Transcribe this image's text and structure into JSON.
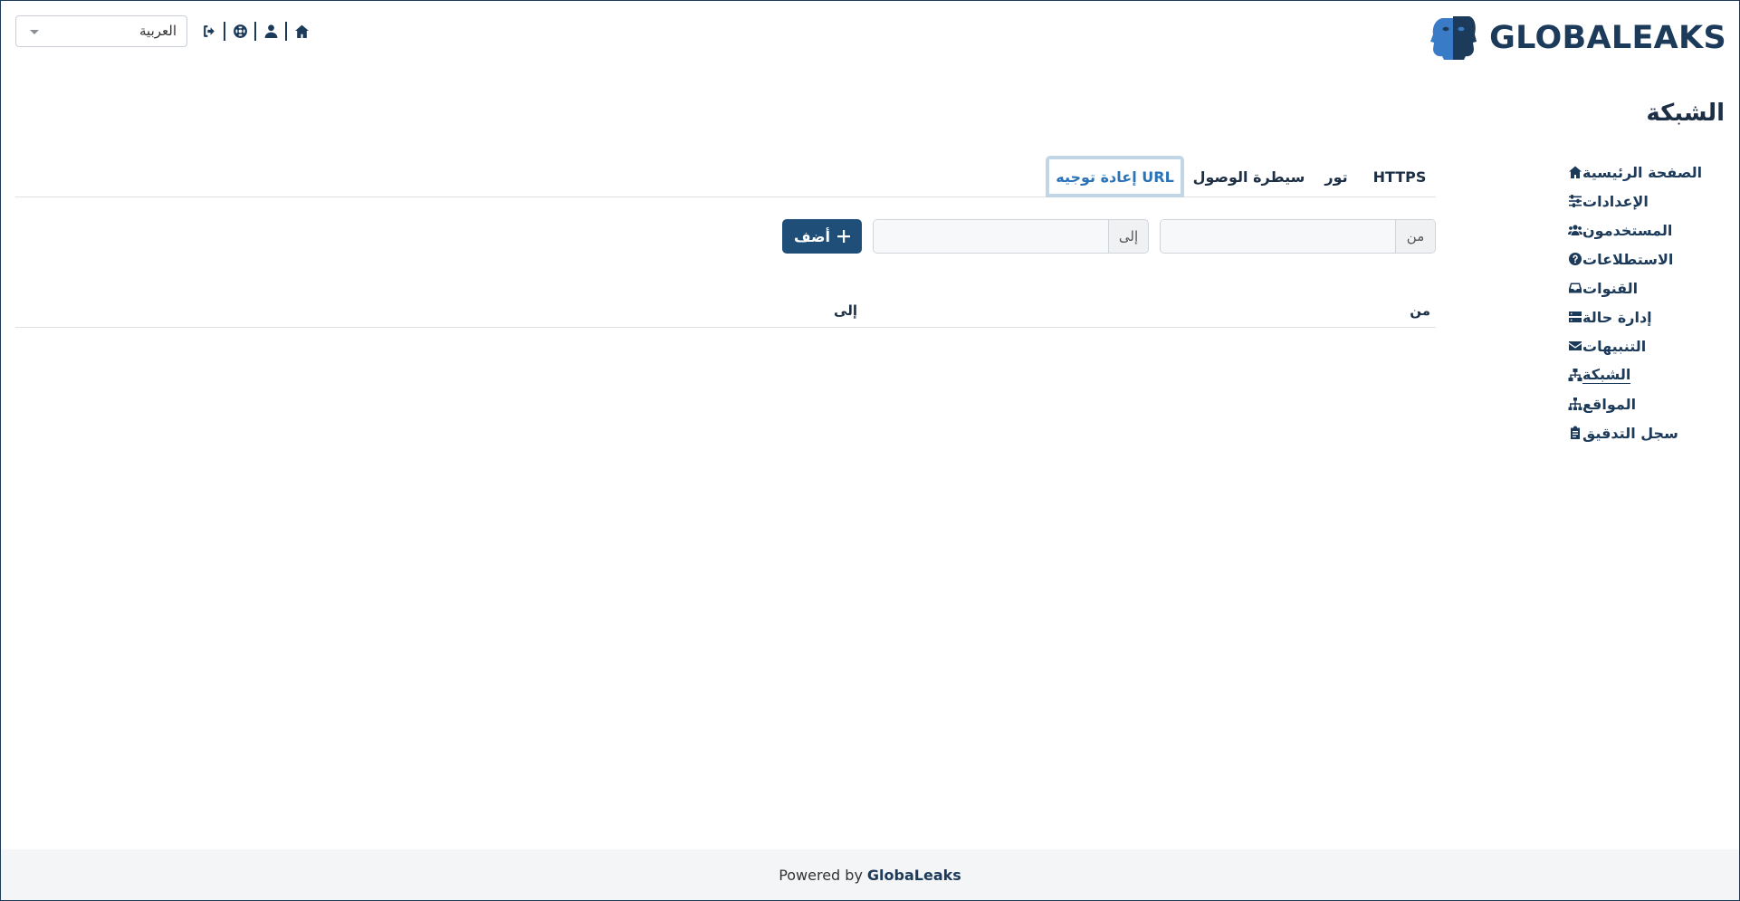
{
  "header": {
    "language": "العربية",
    "logo_text": "GLOBALEAKS",
    "icons": [
      "home-icon",
      "user-icon",
      "support-icon",
      "logout-icon"
    ]
  },
  "page": {
    "title": "الشبكة"
  },
  "sidebar": {
    "items": [
      {
        "label": "الصفحة الرئيسية",
        "icon": "home-icon"
      },
      {
        "label": "الإعدادات",
        "icon": "sliders-icon"
      },
      {
        "label": "المستخدمون",
        "icon": "users-icon"
      },
      {
        "label": "الاستطلاعات",
        "icon": "question-circle-icon"
      },
      {
        "label": "القنوات",
        "icon": "inbox-icon"
      },
      {
        "label": "إدارة حالة",
        "icon": "server-icon"
      },
      {
        "label": "التنبيهات",
        "icon": "envelope-icon"
      },
      {
        "label": "الشبكة",
        "icon": "network-icon",
        "active": true
      },
      {
        "label": "المواقع",
        "icon": "sitemap-icon"
      },
      {
        "label": "سجل التدقيق",
        "icon": "clipboard-icon"
      }
    ]
  },
  "tabs": [
    {
      "label": "HTTPS"
    },
    {
      "label": "تور"
    },
    {
      "label": "سيطرة الوصول"
    },
    {
      "label": "إعادة توجيه URL",
      "active": true
    }
  ],
  "form": {
    "from_label": "من",
    "from_value": "",
    "to_label": "إلى",
    "to_value": "",
    "add_label": "أضف"
  },
  "table": {
    "columns": [
      "من",
      "إلى"
    ],
    "rows": []
  },
  "footer": {
    "prefix": "Powered by",
    "brand": "GlobaLeaks"
  },
  "colors": {
    "primary": "#1c3a5a",
    "accent": "#2a73b8",
    "button": "#1f4e79"
  }
}
